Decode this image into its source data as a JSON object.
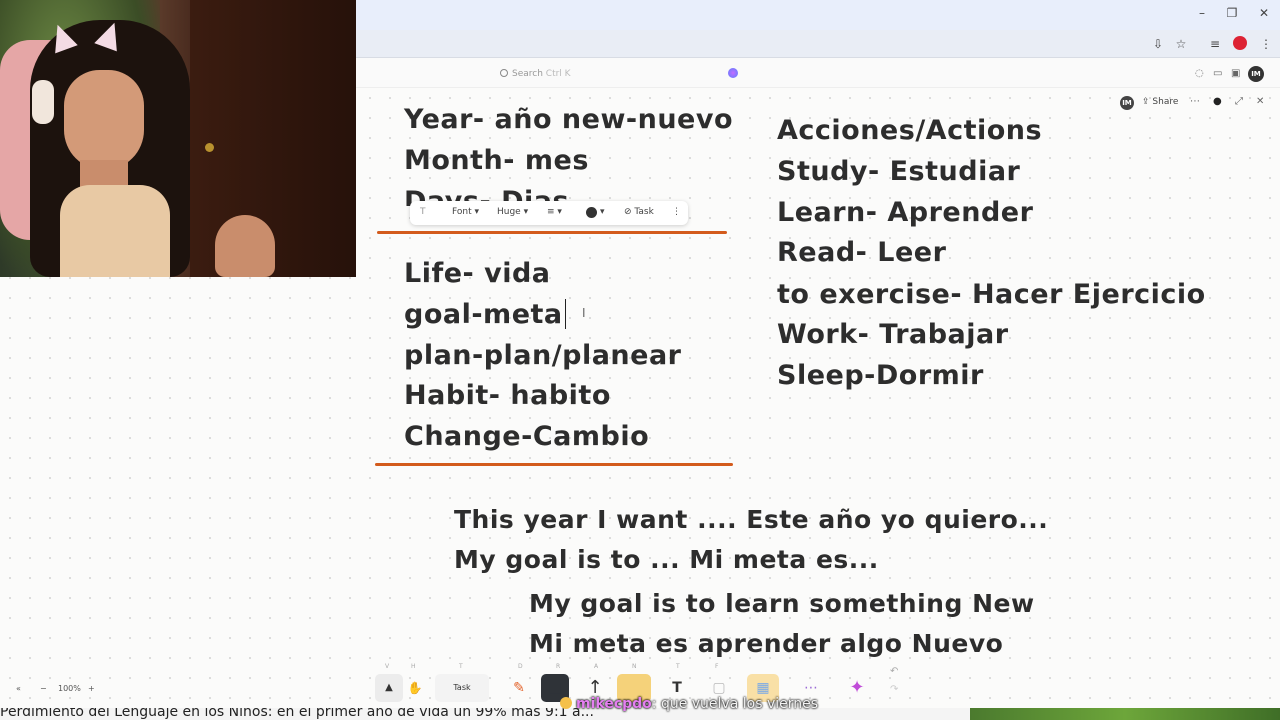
{
  "browser": {
    "window_controls": [
      "–",
      "❐",
      "✕"
    ]
  },
  "app": {
    "search_label": "Search",
    "search_shortcut": "Ctrl K",
    "avatar_initials": "IM",
    "share_label": "Share",
    "more_label": "⋯"
  },
  "text_toolbar": {
    "type_label": "T",
    "font_label": "Font",
    "size_label": "Huge",
    "align_label": "≡",
    "task_label": "Task",
    "more_label": "⋮"
  },
  "board": {
    "left_column_top": [
      "Year- año  new-nuevo",
      "Month- mes",
      "Days- Dias"
    ],
    "left_column_words": [
      "Life- vida",
      "goal-meta",
      "plan-plan/planear",
      "Habit- habito",
      "Change-Cambio"
    ],
    "right_column": [
      "Acciones/Actions",
      "Study- Estudiar",
      "Learn- Aprender",
      "Read- Leer",
      "to exercise- Hacer Ejercicio",
      "Work- Trabajar",
      "Sleep-Dormir"
    ],
    "sentences": [
      "This year I want .... Este año yo quiero...",
      "My goal is to ... Mi meta es..."
    ],
    "examples": [
      "My goal is to learn something New",
      "Mi meta es aprender algo Nuevo"
    ],
    "underline_color": "#d35b1c"
  },
  "zoom": {
    "level": "100%",
    "minus": "−",
    "plus": "+",
    "collapse": "«"
  },
  "bottom_tools": [
    {
      "key": "V",
      "icon": "▲",
      "name": "select"
    },
    {
      "key": "H",
      "icon": "✋",
      "name": "hand"
    },
    {
      "key": "T",
      "icon": "Task",
      "name": "task"
    },
    {
      "key": "D",
      "icon": "✎",
      "name": "pen"
    },
    {
      "key": "R",
      "icon": "■",
      "name": "shape"
    },
    {
      "key": "A",
      "icon": "↑",
      "name": "arrow"
    },
    {
      "key": "N",
      "icon": "▭",
      "name": "sticky-note"
    },
    {
      "key": "T",
      "icon": "T",
      "name": "text"
    },
    {
      "key": "F",
      "icon": "▢",
      "name": "frame"
    },
    {
      "key": "",
      "icon": "▦",
      "name": "image"
    },
    {
      "key": "",
      "icon": "⋯",
      "name": "more"
    },
    {
      "key": "",
      "icon": "✦",
      "name": "ai"
    }
  ],
  "chat": {
    "user": "mikecpdo",
    "message": ": que vuelva los viernes"
  },
  "ticker": {
    "text": "Perdimiento del Lenguaje en los Niños: en el primer año de vida un 99% más 9:1 a..."
  }
}
